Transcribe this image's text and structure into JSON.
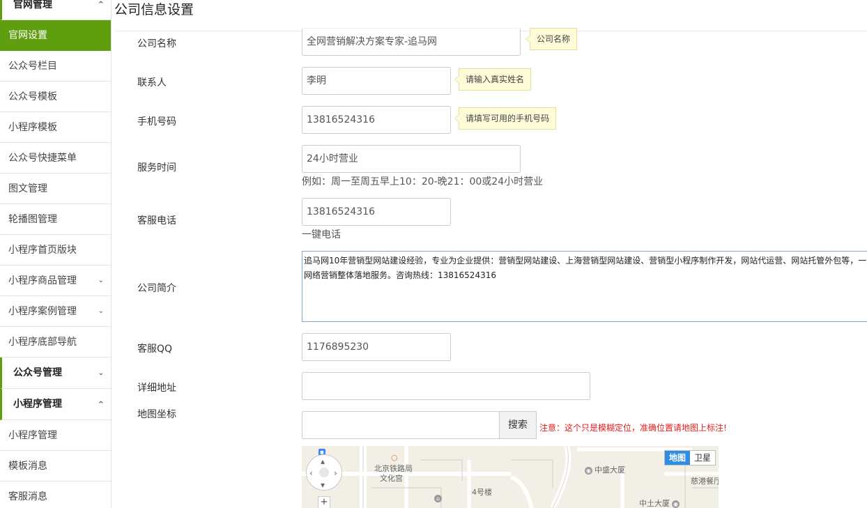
{
  "sidebar": {
    "group_website": "官网管理",
    "items_website": [
      "官网设置",
      "公众号栏目",
      "公众号模板",
      "小程序模板",
      "公众号快捷菜单",
      "图文管理",
      "轮播图管理",
      "小程序首页版块",
      "小程序商品管理",
      "小程序案例管理",
      "小程序底部导航"
    ],
    "group_official": "公众号管理",
    "group_mini": "小程序管理",
    "items_mini": [
      "小程序管理",
      "模板消息",
      "客服消息"
    ],
    "chevron_up": "^",
    "chevron_down": "⌄"
  },
  "page": {
    "title": "公司信息设置"
  },
  "form": {
    "company_name": {
      "label": "公司名称",
      "value": "全网营销解决方案专家-追马网",
      "tip": "公司名称"
    },
    "contact": {
      "label": "联系人",
      "value": "李明",
      "tip": "请输入真实姓名"
    },
    "mobile": {
      "label": "手机号码",
      "value": "13816524316",
      "tip": "请填写可用的手机号码"
    },
    "service_time": {
      "label": "服务时间",
      "value": "24小时营业",
      "hint": "例如：周一至周五早上10：20-晚21：00或24小时营业"
    },
    "service_phone": {
      "label": "客服电话",
      "value": "13816524316",
      "hint": "一键电话"
    },
    "intro": {
      "label": "公司简介",
      "line1": "追马网10年营销型网站建设经验，专业为企业提供：营销型网站建设、上海营销型网站建设、营销型小程序制作开发，网站代运营、网站托管外包等，一站式",
      "line2": "网络营销整体落地服务。咨询热线：13816524316"
    },
    "qq": {
      "label": "客服QQ",
      "value": "1176895230"
    },
    "address": {
      "label": "详细地址",
      "value": ""
    },
    "map_coord": {
      "label": "地图坐标",
      "value": "",
      "search_label": "搜索",
      "note": "注意：这个只是模糊定位，准确位置请地图上标注!"
    }
  },
  "map": {
    "type_map": "地图",
    "type_satellite": "卫星",
    "poi1": "北京铁路局",
    "poi1b": "文化宫",
    "poi2": "中盛大厦",
    "poi3": "4号楼",
    "poi4": "中土大厦",
    "poi5": "慈港餐厅",
    "zoom_in": "+"
  }
}
